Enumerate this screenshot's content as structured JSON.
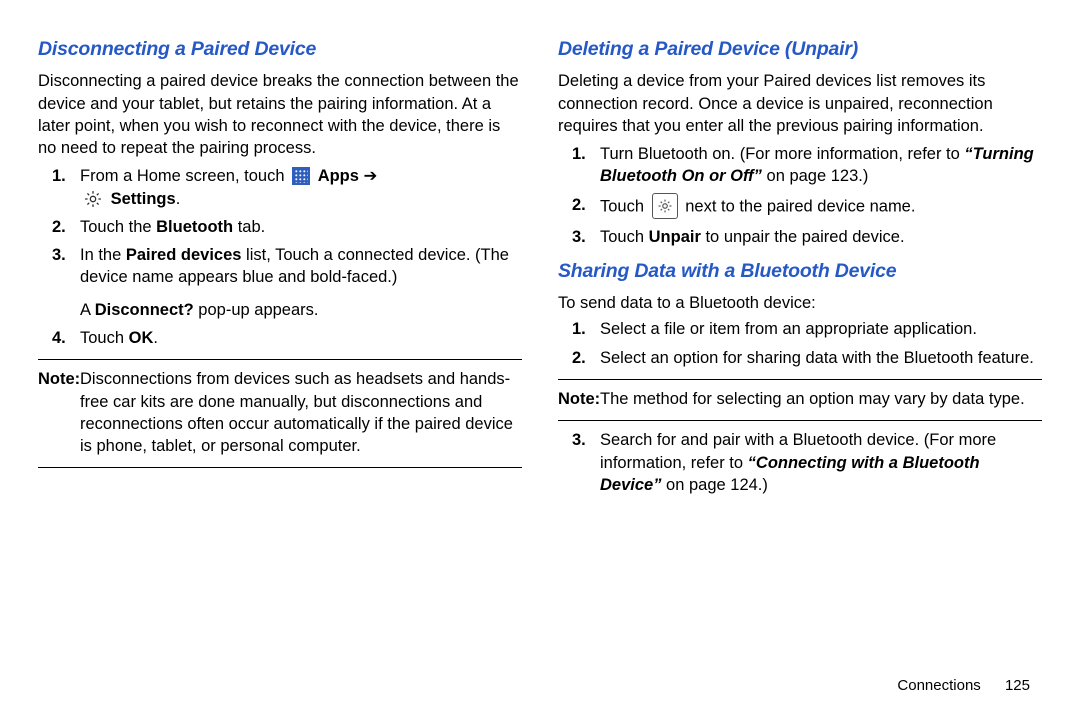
{
  "left": {
    "heading": "Disconnecting a Paired Device",
    "intro": "Disconnecting a paired device breaks the connection between the device and your tablet, but retains the pairing information. At a later point, when you wish to reconnect with the device, there is no need to repeat the pairing process.",
    "step1_a": "From a Home screen, touch",
    "step1_apps": "Apps",
    "step1_arrow": "➔",
    "step1_settings": "Settings",
    "step1_dot": ".",
    "step2_a": "Touch the ",
    "step2_b": "Bluetooth",
    "step2_c": " tab.",
    "step3_a": "In the ",
    "step3_b": "Paired devices",
    "step3_c": " list, Touch a connected device. (The device name appears blue and bold-faced.)",
    "step3_popup_a": "A ",
    "step3_popup_b": "Disconnect?",
    "step3_popup_c": " pop-up appears.",
    "step4_a": "Touch ",
    "step4_b": "OK",
    "step4_c": ".",
    "note_label": "Note:",
    "note_text": "Disconnections from devices such as headsets and hands-free car kits are done manually, but disconnections and reconnections often occur automatically if the paired device is phone, tablet, or personal computer."
  },
  "right": {
    "heading1": "Deleting a Paired Device (Unpair)",
    "intro1": "Deleting a device from your Paired devices list removes its connection record. Once a device is unpaired, reconnection requires that you enter all the previous pairing information.",
    "r1_step1_a": "Turn Bluetooth on. (For more information, refer to ",
    "r1_step1_b": "“Turning Bluetooth On or Off”",
    "r1_step1_c": " on page 123.)",
    "r1_step2_a": "Touch",
    "r1_step2_b": "next to the paired device name.",
    "r1_step3_a": "Touch ",
    "r1_step3_b": "Unpair",
    "r1_step3_c": " to unpair the paired device.",
    "heading2": "Sharing Data with a Bluetooth Device",
    "intro2": "To send data to a Bluetooth device:",
    "r2_step1": "Select a file or item from an appropriate application.",
    "r2_step2": "Select an option for sharing data with the Bluetooth feature.",
    "note2_label": "Note:",
    "note2_text": "The method for selecting an option may vary by data type.",
    "r2_step3_a": "Search for and pair with a Bluetooth device. (For more information, refer to ",
    "r2_step3_b": "“Connecting with a Bluetooth Device”",
    "r2_step3_c": " on page 124.)"
  },
  "footer": {
    "section": "Connections",
    "page": "125"
  },
  "nums": {
    "n1": "1.",
    "n2": "2.",
    "n3": "3.",
    "n4": "4."
  }
}
